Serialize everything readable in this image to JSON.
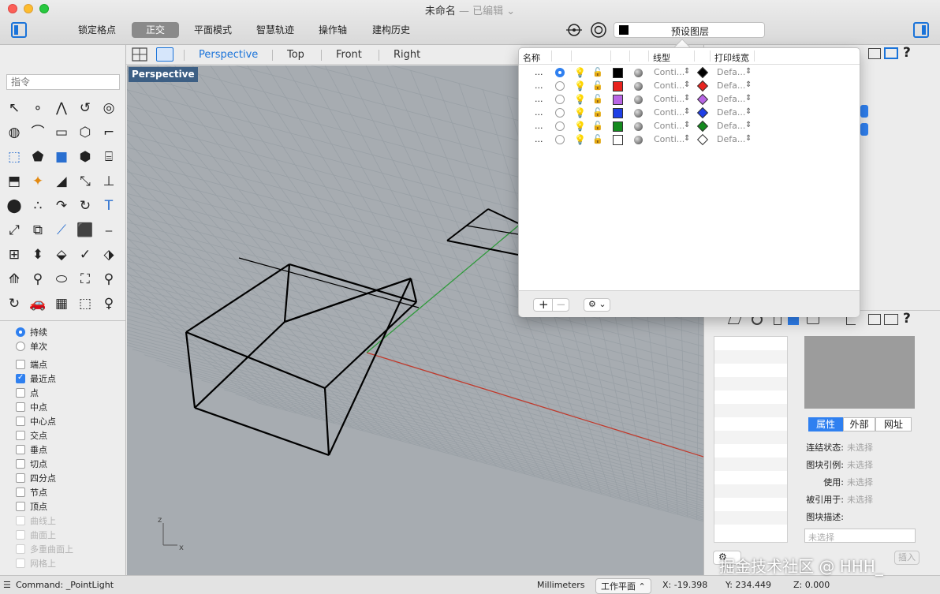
{
  "window": {
    "title": "未命名",
    "subtitle": "— 已编辑 ⌄"
  },
  "toolbar": {
    "buttons": [
      "锁定格点",
      "正交",
      "平面模式",
      "智慧轨迹",
      "操作轴",
      "建构历史"
    ],
    "active_index": 1,
    "layer_label": "预设图层"
  },
  "viewport_tabs": [
    "Perspective",
    "Top",
    "Front",
    "Right"
  ],
  "viewport_label": "Perspective",
  "command_placeholder": "指令",
  "snaps": {
    "mode": [
      {
        "label": "持续",
        "selected": true
      },
      {
        "label": "单次",
        "selected": false
      }
    ],
    "items": [
      {
        "label": "端点",
        "checked": false,
        "enabled": true
      },
      {
        "label": "最近点",
        "checked": true,
        "enabled": true
      },
      {
        "label": "点",
        "checked": false,
        "enabled": true
      },
      {
        "label": "中点",
        "checked": false,
        "enabled": true
      },
      {
        "label": "中心点",
        "checked": false,
        "enabled": true
      },
      {
        "label": "交点",
        "checked": false,
        "enabled": true
      },
      {
        "label": "垂点",
        "checked": false,
        "enabled": true
      },
      {
        "label": "切点",
        "checked": false,
        "enabled": true
      },
      {
        "label": "四分点",
        "checked": false,
        "enabled": true
      },
      {
        "label": "节点",
        "checked": false,
        "enabled": true
      },
      {
        "label": "顶点",
        "checked": false,
        "enabled": true
      },
      {
        "label": "曲线上",
        "checked": false,
        "enabled": false
      },
      {
        "label": "曲面上",
        "checked": false,
        "enabled": false
      },
      {
        "label": "多重曲面上",
        "checked": false,
        "enabled": false
      },
      {
        "label": "网格上",
        "checked": false,
        "enabled": false
      }
    ]
  },
  "layers": {
    "headers": {
      "name": "名称",
      "linetype": "线型",
      "printwidth": "打印线宽"
    },
    "rows": [
      {
        "name": "...",
        "current": true,
        "color": "#000000",
        "linetype": "Conti...",
        "printwidth": "Defa..."
      },
      {
        "name": "...",
        "current": false,
        "color": "#e8231e",
        "linetype": "Conti...",
        "printwidth": "Defa..."
      },
      {
        "name": "...",
        "current": false,
        "color": "#b966e6",
        "linetype": "Conti...",
        "printwidth": "Defa..."
      },
      {
        "name": "...",
        "current": false,
        "color": "#1f3fe6",
        "linetype": "Conti...",
        "printwidth": "Defa..."
      },
      {
        "name": "...",
        "current": false,
        "color": "#148a1e",
        "linetype": "Conti...",
        "printwidth": "Defa..."
      },
      {
        "name": "...",
        "current": false,
        "color": "#ffffff",
        "linetype": "Conti...",
        "printwidth": "Defa..."
      }
    ]
  },
  "properties": {
    "tabs": [
      "属性",
      "外部",
      "网址"
    ],
    "active_tab": 0,
    "fields": [
      {
        "label": "连结状态:",
        "value": "未选择"
      },
      {
        "label": "图块引例:",
        "value": "未选择"
      },
      {
        "label": "使用:",
        "value": "未选择"
      },
      {
        "label": "被引用于:",
        "value": "未选择"
      },
      {
        "label": "图块描述:",
        "value": ""
      }
    ],
    "desc_placeholder": "未选择",
    "insert_label": "插入"
  },
  "statusbar": {
    "command": "Command: _PointLight",
    "units": "Millimeters",
    "cplane": "工作平面 ⌃",
    "x": "X: -19.398",
    "y": "Y: 234.449",
    "z": "Z: 0.000"
  },
  "watermark": "掘金技术社区 @ HHH_",
  "axes": {
    "z": "z",
    "x": "x"
  }
}
